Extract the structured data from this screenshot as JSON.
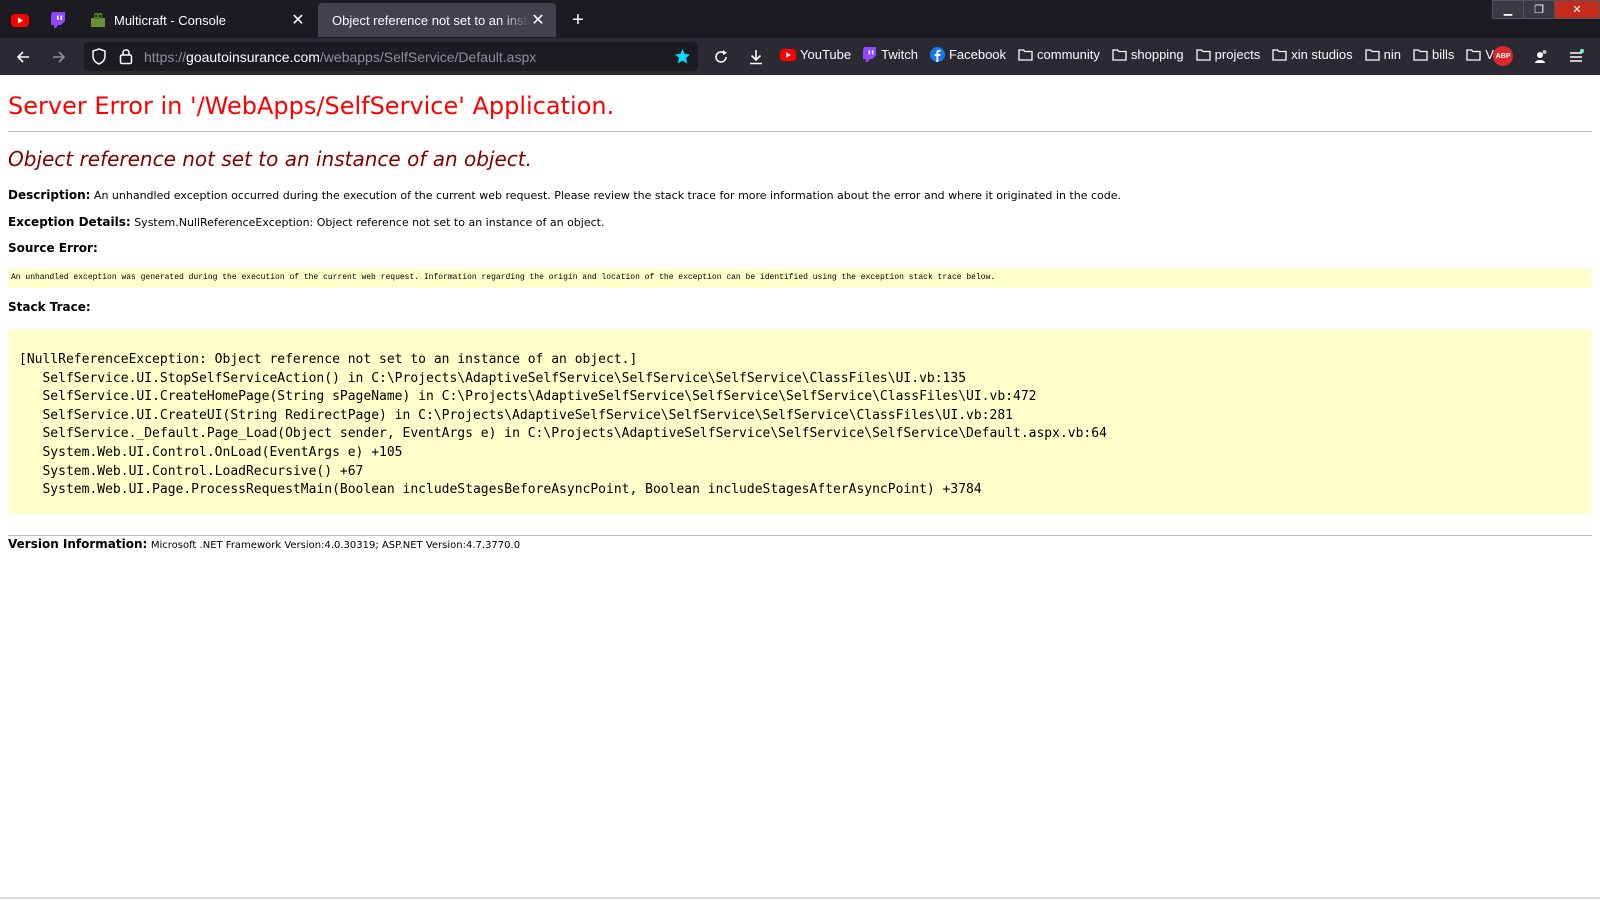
{
  "browser": {
    "tabs": [
      {
        "title": "Multicraft - Console",
        "active": false
      },
      {
        "title": "Object reference not set to an instance of an object.",
        "active": true
      }
    ],
    "url_scheme": "https://",
    "url_host": "goautoinsurance.com",
    "url_path": "/webapps/SelfService/Default.aspx",
    "bookmarks": [
      {
        "label": "YouTube",
        "icon": "youtube-icon"
      },
      {
        "label": "Twitch",
        "icon": "twitch-icon"
      },
      {
        "label": "Facebook",
        "icon": "facebook-icon"
      },
      {
        "label": "community",
        "icon": "folder-icon"
      },
      {
        "label": "shopping",
        "icon": "folder-icon"
      },
      {
        "label": "projects",
        "icon": "folder-icon"
      },
      {
        "label": "xin studios",
        "icon": "folder-icon"
      },
      {
        "label": "nin",
        "icon": "folder-icon"
      },
      {
        "label": "bills",
        "icon": "folder-icon"
      },
      {
        "label": "V",
        "icon": "folder-icon"
      }
    ],
    "abp_label": "ABP"
  },
  "page": {
    "title": "Server Error in '/WebApps/SelfService' Application.",
    "subtitle": "Object reference not set to an instance of an object.",
    "description_label": "Description:",
    "description_text": "An unhandled exception occurred during the execution of the current web request. Please review the stack trace for more information about the error and where it originated in the code.",
    "exception_label": "Exception Details:",
    "exception_text": "System.NullReferenceException: Object reference not set to an instance of an object.",
    "source_error_label": "Source Error:",
    "source_error_text": "An unhandled exception was generated during the execution of the current web request. Information regarding the origin and location of the exception can be identified using the exception stack trace below.",
    "stack_trace_label": "Stack Trace:",
    "stack_trace": "[NullReferenceException: Object reference not set to an instance of an object.]\n   SelfService.UI.StopSelfServiceAction() in C:\\Projects\\AdaptiveSelfService\\SelfService\\SelfService\\ClassFiles\\UI.vb:135\n   SelfService.UI.CreateHomePage(String sPageName) in C:\\Projects\\AdaptiveSelfService\\SelfService\\SelfService\\ClassFiles\\UI.vb:472\n   SelfService.UI.CreateUI(String RedirectPage) in C:\\Projects\\AdaptiveSelfService\\SelfService\\SelfService\\ClassFiles\\UI.vb:281\n   SelfService._Default.Page_Load(Object sender, EventArgs e) in C:\\Projects\\AdaptiveSelfService\\SelfService\\SelfService\\Default.aspx.vb:64\n   System.Web.UI.Control.OnLoad(EventArgs e) +105\n   System.Web.UI.Control.LoadRecursive() +67\n   System.Web.UI.Page.ProcessRequestMain(Boolean includeStagesBeforeAsyncPoint, Boolean includeStagesAfterAsyncPoint) +3784",
    "version_label": "Version Information:",
    "version_text": "Microsoft .NET Framework Version:4.0.30319; ASP.NET Version:4.7.3770.0"
  },
  "colors": {
    "title": "#ff0000",
    "subtitle": "#800000",
    "codebox": "#ffffcc",
    "bookmark_star": "#00ddff"
  }
}
